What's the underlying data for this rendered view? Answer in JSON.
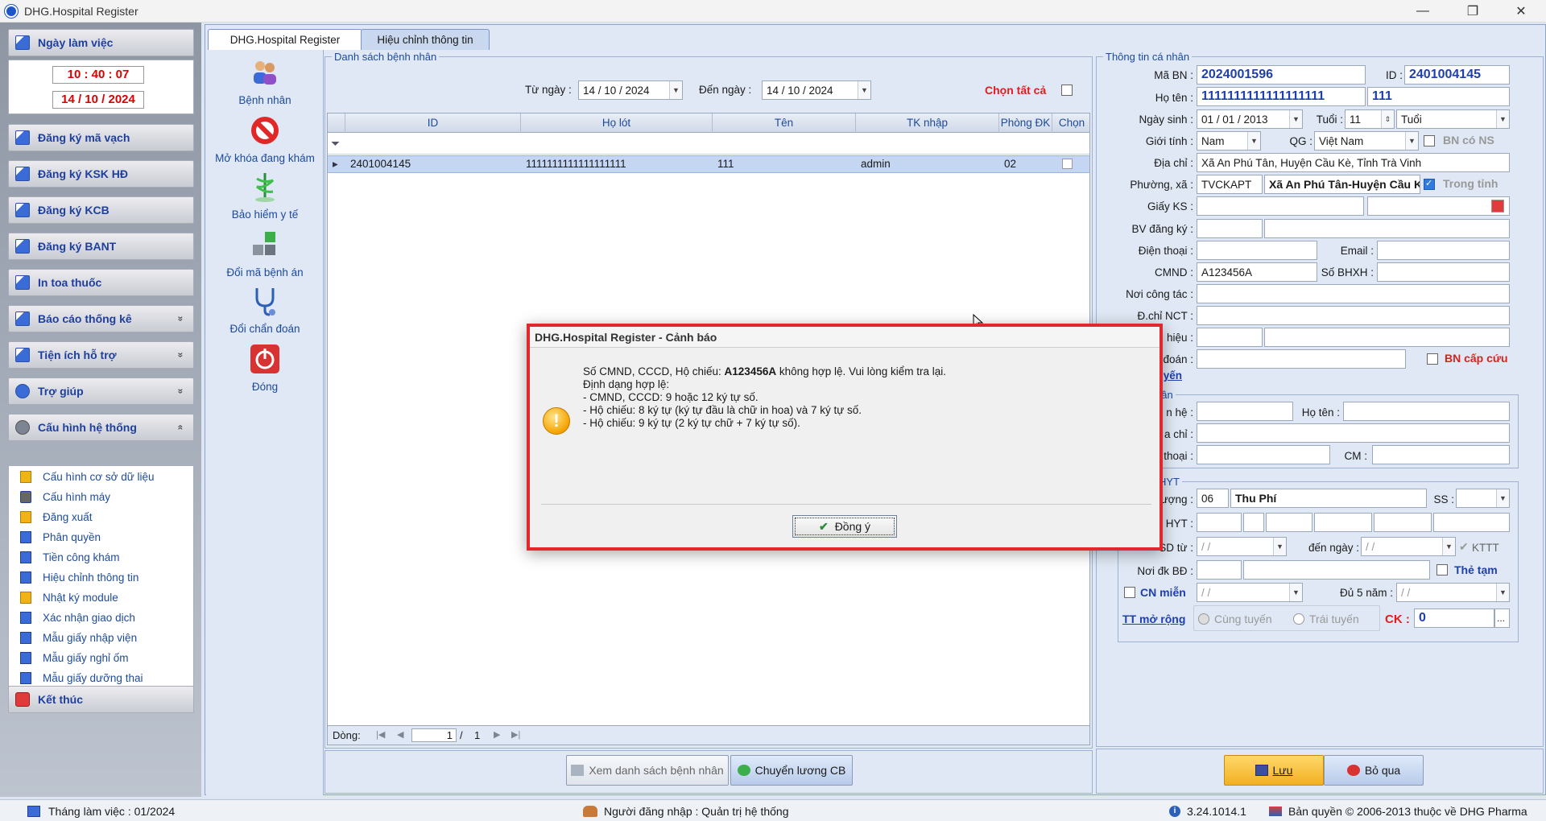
{
  "window": {
    "title": "DHG.Hospital Register",
    "min": "—",
    "max": "❐",
    "close": "✕"
  },
  "left": {
    "workday": {
      "header": "Ngày làm việc",
      "time": "10 : 40 : 07",
      "date": "14 / 10 / 2024"
    },
    "groups": [
      "Đăng ký mã vạch",
      "Đăng ký KSK HĐ",
      "Đăng ký KCB",
      "Đăng ký BANT",
      "In toa thuốc",
      "Báo cáo thống kê",
      "Tiện ích hỗ trợ",
      "Trợ giúp",
      "Cấu hình hệ thống"
    ],
    "chev_down": "»",
    "chev_up": "«",
    "subitems": [
      "Cấu hình cơ sở dữ liệu",
      "Cấu hình máy",
      "Đăng xuất",
      "Phân quyền",
      "Tiền công khám",
      "Hiệu chỉnh thông tin",
      "Nhật ký module",
      "Xác nhận giao dịch",
      "Mẫu giấy nhập viện",
      "Mẫu giấy nghỉ ốm",
      "Mẫu giấy dưỡng thai"
    ],
    "exit": "Kết thúc"
  },
  "tabs": [
    "DHG.Hospital Register",
    "Hiệu chỉnh thông tin"
  ],
  "tools": [
    "Bệnh nhân",
    "Mở khóa đang khám",
    "Bảo hiểm y tế",
    "Đổi mã bệnh án",
    "Đổi chẩn đoán",
    "Đóng"
  ],
  "list": {
    "title": "Danh sách bệnh nhân",
    "from_label": "Từ ngày :",
    "from_value": "14 / 10 / 2024",
    "to_label": "Đến  ngày :",
    "to_value": "14 / 10 / 2024",
    "select_all": "Chọn tất cả",
    "columns": [
      "ID",
      "Họ lót",
      "Tên",
      "TK nhập",
      "Phòng ĐK",
      "Chọn"
    ],
    "rows": [
      {
        "id": "2401004145",
        "holot": "1111111111111111111",
        "ten": "111",
        "tk": "admin",
        "phong": "02"
      }
    ],
    "footer": {
      "label": "Dòng:",
      "page": "1",
      "sep": "/",
      "total": "1",
      "first": "|◀",
      "prev": "◀",
      "next": "▶",
      "last": "▶|"
    },
    "view_btn": "Xem danh sách bệnh nhân",
    "move_btn": "Chuyển lương CB"
  },
  "info": {
    "title": "Thông tin cá nhân",
    "ma_bn_label": "Mã BN :",
    "ma_bn": "2024001596",
    "id_label": "ID :",
    "id": "2401004145",
    "hoten_label": "Họ tên :",
    "ho": "1111111111111111111",
    "ten": "111",
    "ngaysinh_label": "Ngày sinh :",
    "ngaysinh": "01 / 01 / 2013",
    "tuoi_label": "Tuổi :",
    "tuoi": "11",
    "tuoi_unit": "Tuổi",
    "gioitinh_label": "Giới tính :",
    "gioitinh": "Nam",
    "qg_label": "QG :",
    "qg": "Việt Nam",
    "bn_co_ns": "BN có NS",
    "diachi_label": "Địa chỉ :",
    "diachi": "Xã An Phú Tân, Huyện Cầu Kè, Tỉnh Trà Vinh",
    "phuongxa_label": "Phường, xã :",
    "px_code": "TVCKAPT",
    "px_name": "Xã An Phú Tân-Huyện Cầu Kè",
    "trong_tinh": "Trong tỉnh",
    "giayks_label": "Giấy KS :",
    "bvdk_label": "BV đăng ký :",
    "dienthoai_label": "Điện thoại :",
    "email_label": "Email :",
    "cmnd_label": "CMND :",
    "cmnd": "A123456A",
    "sobhxh_label": "Số BHXH :",
    "noicongtac_label": "Nơi công tác :",
    "dchinct_label": "Đ.chỉ NCT :",
    "hieu_label": "hiệu :",
    "doan_label": "đoán :",
    "bn_cap_cuu": "BN cấp cứu",
    "tuyen_link": "n tuyến",
    "nhan_title": "hân",
    "quanhe_label": "n hệ :",
    "hoten2_label": "Họ tên :",
    "diachi2_label": "a chỉ :",
    "dthoai2_label": "thoại :",
    "cm_label": "CM :",
    "bhyt_title": "HYT",
    "doituong_label": "ượng :",
    "doituong_code": "06",
    "doituong": "Thu Phí",
    "ss_label": "SS :",
    "sothe_label": "HYT :",
    "hansd_label": "SD từ :",
    "hansd_from": "  /    /",
    "den_ngay_label": "đến  ngày :",
    "hansd_to": "  /    /",
    "kttt": "KTTT",
    "noidk_label": "Nơi đk BĐ :",
    "the_tam": "Thẻ tạm",
    "cn_mien": "CN miễn",
    "cn_date": "  /    /",
    "du5nam_label": "Đủ 5 năm :",
    "du5_date": "  /    /",
    "tt_mo_rong": "TT mở rộng",
    "cung_tuyen": "Cùng tuyến",
    "trai_tuyen": "Trái tuyến",
    "ck_label": "CK :",
    "ck": "0",
    "ck_btn": "...",
    "save_btn": "Lưu",
    "skip_btn": "Bỏ qua"
  },
  "dialog": {
    "title": "DHG.Hospital Register - Cảnh báo",
    "line1_pre": "Số CMND, CCCD, Hộ chiếu: ",
    "line1_val": "A123456A",
    "line1_post": " không hợp lệ. Vui lòng kiểm tra lại.",
    "line2": "Định dạng hợp lệ:",
    "line3": " - CMND, CCCD: 9 hoặc 12 ký tự số.",
    "line4": " - Hộ chiếu: 8 ký tự (ký tự đầu là chữ in hoa) và 7 ký tự số.",
    "line5": " - Hộ chiếu: 9 ký tự (2 ký tự chữ + 7 ký tự số).",
    "icon": "!",
    "ok": "Đồng ý"
  },
  "status": {
    "month": "Tháng làm việc : 01/2024",
    "user": "Người đăng nhập : Quản trị hệ thống",
    "version": "3.24.1014.1",
    "copyright": "Bản quyền © 2006-2013 thuộc về DHG Pharma"
  }
}
